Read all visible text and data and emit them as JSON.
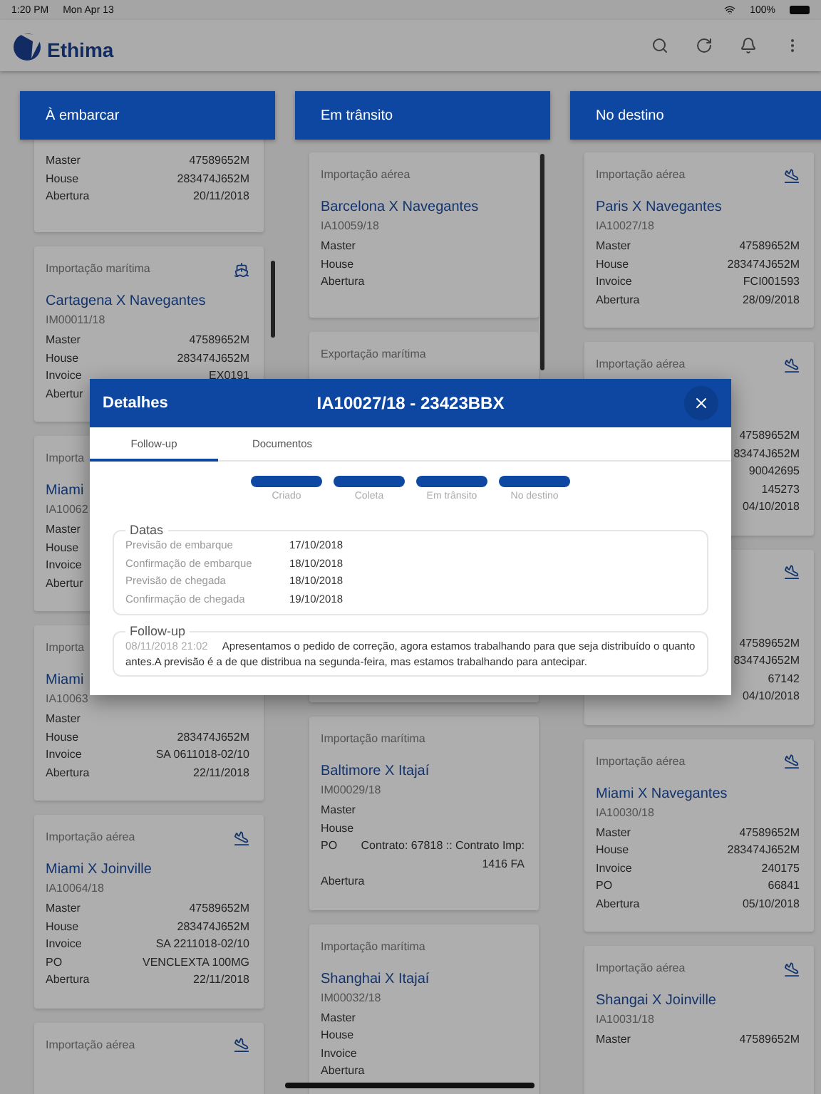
{
  "status_bar": {
    "time": "1:20 PM",
    "date": "Mon Apr 13",
    "battery": "100%"
  },
  "app_bar": {
    "logo": "Ethima"
  },
  "columns": [
    {
      "title": "À embarcar",
      "cards": [
        {
          "rows": [
            {
              "label": "Master",
              "value": "47589652M"
            },
            {
              "label": "House",
              "value": "283474J652M"
            },
            {
              "label": "Abertura",
              "value": "20/11/2018"
            }
          ]
        },
        {
          "kind": "sea",
          "category": "Importação marítima",
          "title": "Cartagena X Navegantes",
          "code": "IM00011/18",
          "rows": [
            {
              "label": "Master",
              "value": "47589652M"
            },
            {
              "label": "House",
              "value": "283474J652M"
            },
            {
              "label": "Invoice",
              "value": "EX0191"
            },
            {
              "label": "Abertur"
            }
          ]
        },
        {
          "category": "Importa",
          "title": "Miami",
          "code": "IA10062",
          "rows": [
            {
              "label": "Master"
            },
            {
              "label": "House"
            },
            {
              "label": "Invoice"
            },
            {
              "label": "Abertur"
            }
          ]
        },
        {
          "category": "Importa",
          "title": "Miami",
          "code": "IA10063",
          "rows": [
            {
              "label": "Master"
            },
            {
              "label": "House",
              "value": "283474J652M"
            },
            {
              "label": "Invoice",
              "value": "SA 0611018-02/10"
            },
            {
              "label": "Abertura",
              "value": "22/11/2018"
            }
          ]
        },
        {
          "kind": "air",
          "category": "Importação aérea",
          "title": "Miami X Joinville",
          "code": "IA10064/18",
          "rows": [
            {
              "label": "Master",
              "value": "47589652M"
            },
            {
              "label": "House",
              "value": "283474J652M"
            },
            {
              "label": "Invoice",
              "value": "SA 2211018-02/10"
            },
            {
              "label": "PO",
              "value": "VENCLEXTA 100MG"
            },
            {
              "label": "Abertura",
              "value": "22/11/2018"
            }
          ]
        },
        {
          "kind": "air",
          "category": "Importação aérea"
        }
      ]
    },
    {
      "title": "Em trânsito",
      "cards": [
        {
          "category": "Importação aérea",
          "title": "Barcelona X Navegantes",
          "code": "IA10059/18",
          "rows": [
            {
              "label": "Master"
            },
            {
              "label": "House"
            },
            {
              "label": "Abertura"
            }
          ]
        },
        {
          "category": "Exportação marítima"
        },
        {
          "category": "Importação marítima",
          "title": "Baltimore X Itajaí",
          "code": "IM00029/18",
          "rows": [
            {
              "label": "Master"
            },
            {
              "label": "House"
            },
            {
              "label": "PO",
              "value": "Contrato: 67818 :: Contrato Imp: 1416 FA"
            },
            {
              "label": "Abertura"
            }
          ]
        },
        {
          "category": "Importação marítima",
          "title": "Shanghai X Itajaí",
          "code": "IM00032/18",
          "rows": [
            {
              "label": "Master"
            },
            {
              "label": "House"
            },
            {
              "label": "Invoice"
            },
            {
              "label": "Abertura"
            }
          ]
        }
      ]
    },
    {
      "title": "No destino",
      "cards": [
        {
          "kind": "air",
          "category": "Importação aérea",
          "title": "Paris X Navegantes",
          "code": "IA10027/18",
          "rows": [
            {
              "label": "Master",
              "value": "47589652M"
            },
            {
              "label": "House",
              "value": "283474J652M"
            },
            {
              "label": "Invoice",
              "value": "FCI001593"
            },
            {
              "label": "Abertura",
              "value": "28/09/2018"
            }
          ]
        },
        {
          "kind": "air",
          "category": "Importação aérea",
          "rows": [
            {
              "value": "47589652M"
            },
            {
              "value": "83474J652M"
            },
            {
              "value": "90042695"
            },
            {
              "value": "145273"
            },
            {
              "value": "04/10/2018"
            }
          ]
        },
        {
          "kind": "air",
          "rows": [
            {
              "value": "47589652M"
            },
            {
              "value": "83474J652M"
            },
            {
              "value": "67142"
            },
            {
              "value": "04/10/2018"
            }
          ]
        },
        {
          "kind": "air",
          "category": "Importação aérea",
          "title": "Miami X Navegantes",
          "code": "IA10030/18",
          "rows": [
            {
              "label": "Master",
              "value": "47589652M"
            },
            {
              "label": "House",
              "value": "283474J652M"
            },
            {
              "label": "Invoice",
              "value": "240175"
            },
            {
              "label": "PO",
              "value": "66841"
            },
            {
              "label": "Abertura",
              "value": "05/10/2018"
            }
          ]
        },
        {
          "kind": "air",
          "category": "Importação aérea",
          "title": "Shangai X Joinville",
          "code": "IA10031/18",
          "rows": [
            {
              "label": "Master",
              "value": "47589652M"
            }
          ]
        }
      ]
    }
  ],
  "modal": {
    "heading": "Detalhes",
    "title": "IA10027/18 - 23423BBX",
    "tabs": [
      {
        "label": "Follow-up",
        "selected": true
      },
      {
        "label": "Documentos",
        "selected": false
      }
    ],
    "steps": [
      {
        "label": "Criado",
        "done": true
      },
      {
        "label": "Coleta",
        "done": true
      },
      {
        "label": "Em trânsito",
        "done": true
      },
      {
        "label": "No destino",
        "done": true
      }
    ],
    "dates": {
      "legend": "Datas",
      "rows": [
        {
          "label": "Previsão de embarque",
          "value": "17/10/2018"
        },
        {
          "label": "Confirmação de embarque",
          "value": "18/10/2018"
        },
        {
          "label": "Previsão de chegada",
          "value": "18/10/2018"
        },
        {
          "label": "Confirmação de chegada",
          "value": "19/10/2018"
        }
      ]
    },
    "followup": {
      "legend": "Follow-up",
      "entries": [
        {
          "time": "08/11/2018 21:02",
          "text": "Apresentamos o pedido de correção, agora estamos trabalhando para que seja distribuído o quanto antes.A previsão é a de que distribua na segunda-feira, mas estamos trabalhando para antecipar."
        }
      ]
    }
  }
}
